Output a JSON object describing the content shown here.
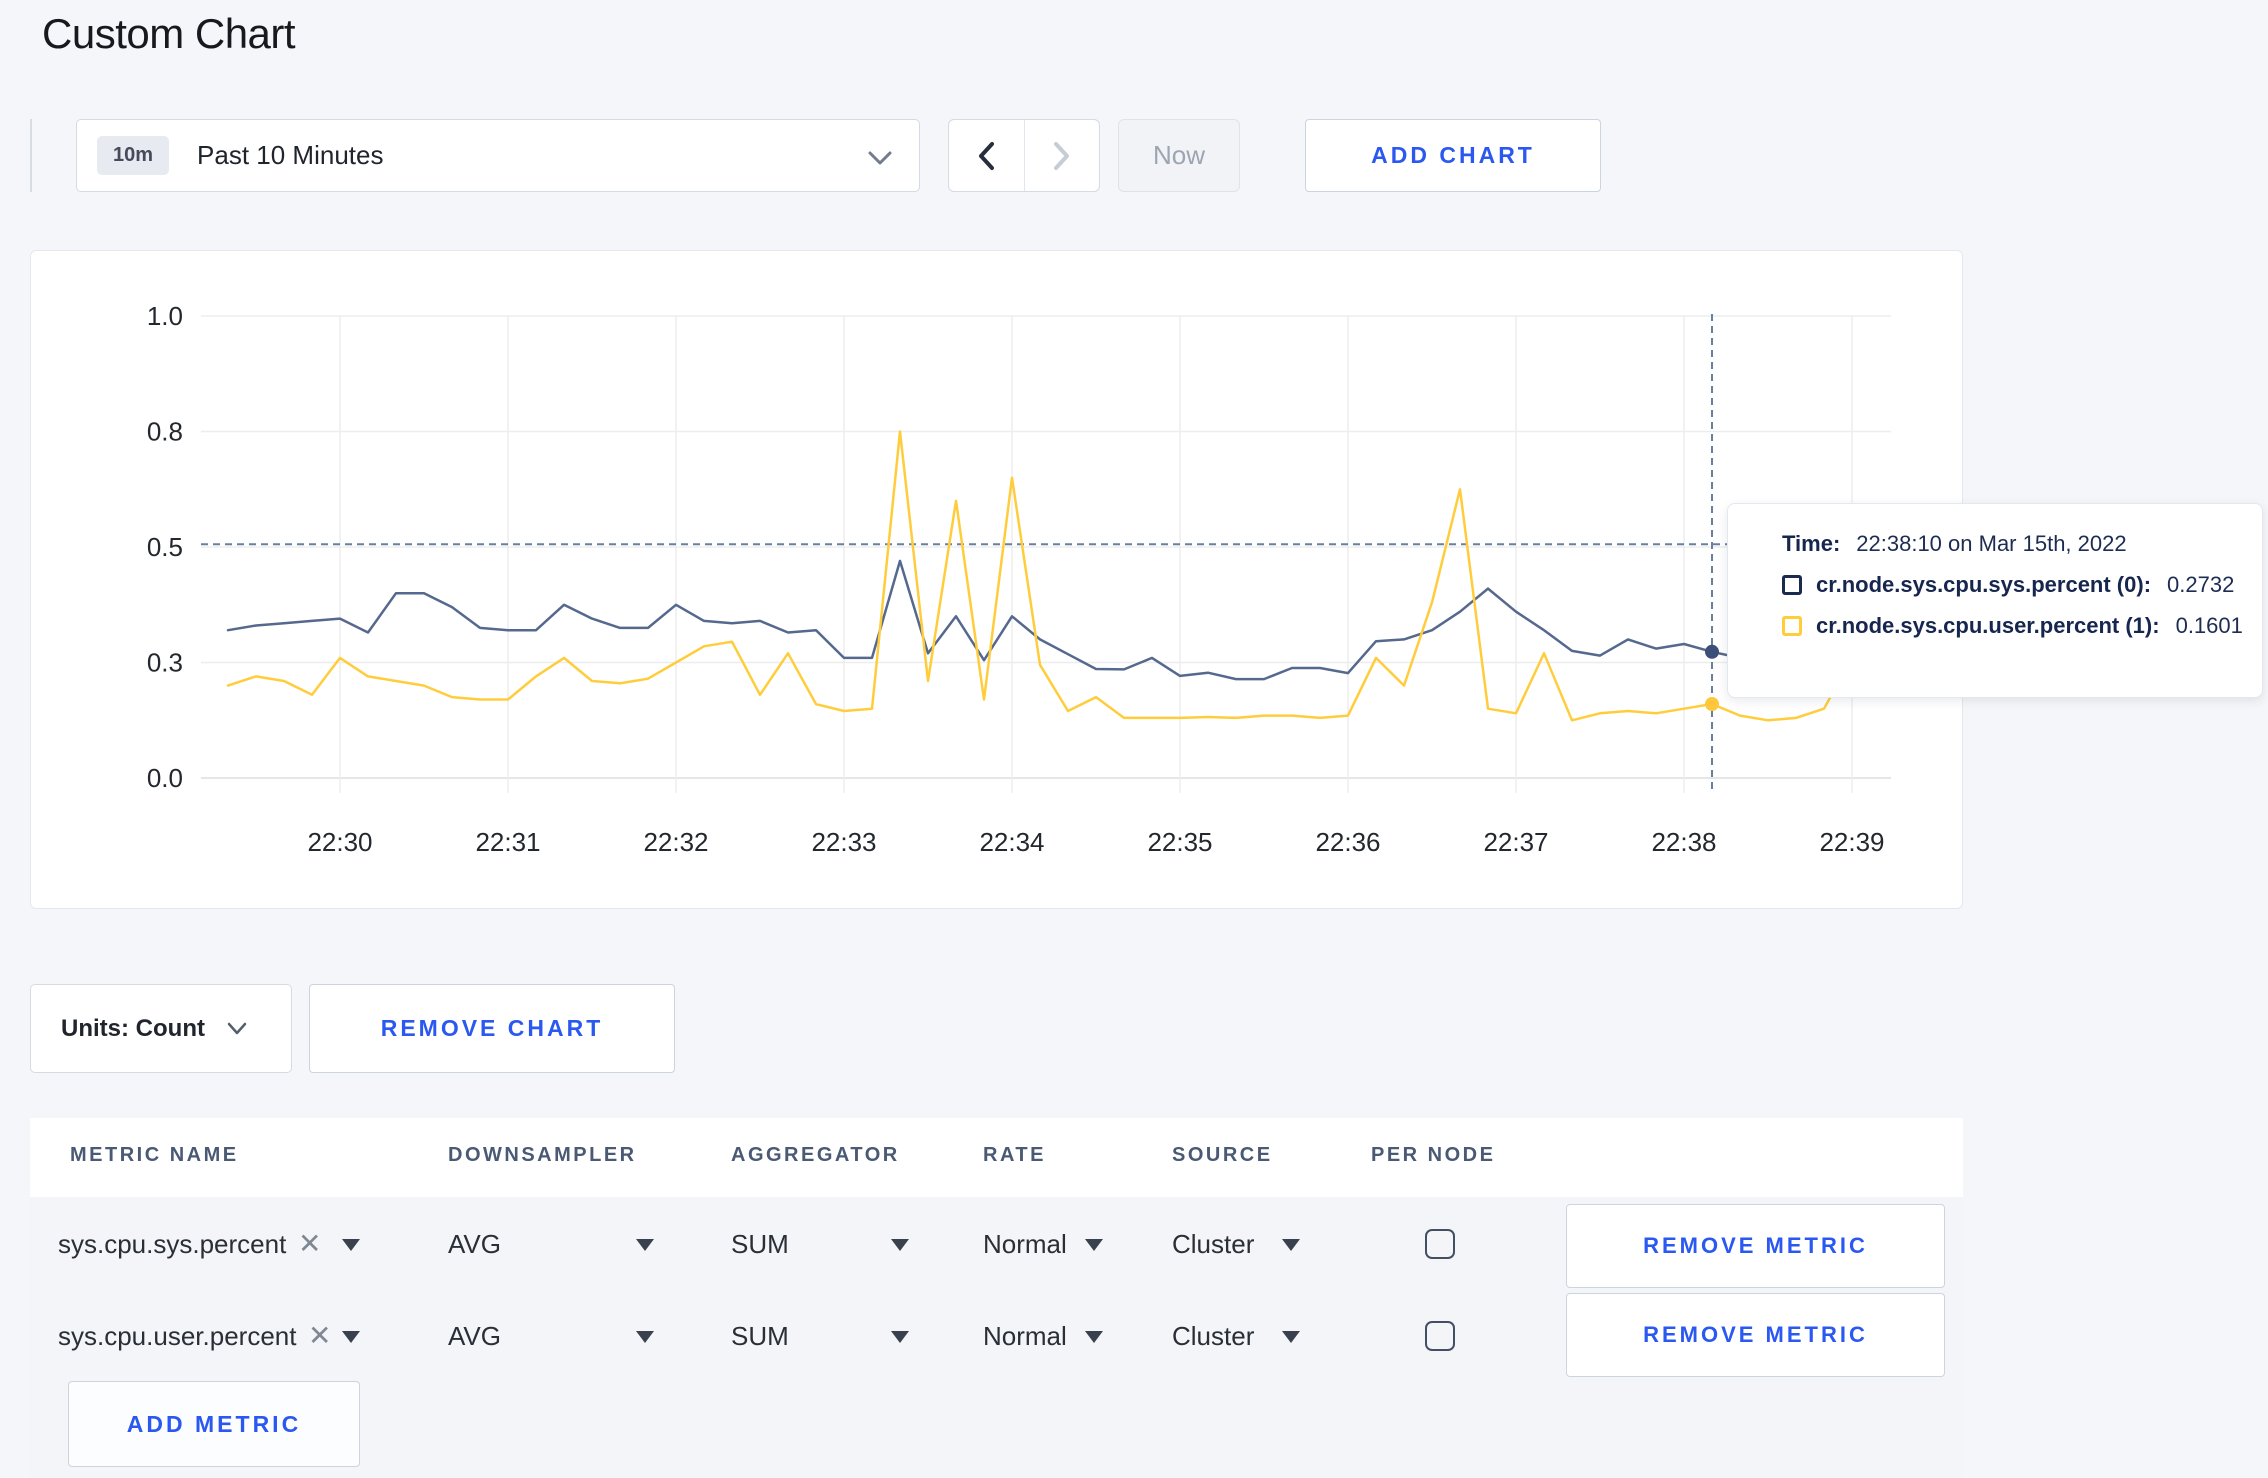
{
  "page": {
    "title": "Custom Chart"
  },
  "toolbar": {
    "time_badge": "10m",
    "time_label": "Past 10 Minutes",
    "now_label": "Now",
    "add_chart_label": "ADD CHART"
  },
  "tooltip": {
    "time_label": "Time:",
    "time_value": "22:38:10 on Mar 15th, 2022",
    "rows": [
      {
        "name": "cr.node.sys.cpu.sys.percent (0):",
        "value": "0.2732",
        "color": "#1b2b4e"
      },
      {
        "name": "cr.node.sys.cpu.user.percent (1):",
        "value": "0.1601",
        "color": "#ffcd3c"
      }
    ]
  },
  "units_bar": {
    "units_label": "Units: Count",
    "remove_chart_label": "REMOVE CHART"
  },
  "metrics_table": {
    "headers": [
      "METRIC NAME",
      "DOWNSAMPLER",
      "AGGREGATOR",
      "RATE",
      "SOURCE",
      "PER NODE"
    ],
    "rows": [
      {
        "metric": "sys.cpu.sys.percent",
        "downsampler": "AVG",
        "aggregator": "SUM",
        "rate": "Normal",
        "source": "Cluster",
        "per_node_checked": false,
        "remove_label": "REMOVE METRIC"
      },
      {
        "metric": "sys.cpu.user.percent",
        "downsampler": "AVG",
        "aggregator": "SUM",
        "rate": "Normal",
        "source": "Cluster",
        "per_node_checked": false,
        "remove_label": "REMOVE METRIC"
      }
    ],
    "add_metric_label": "ADD METRIC"
  },
  "chart_data": {
    "type": "line",
    "title": "",
    "xlabel": "",
    "ylabel": "",
    "ylim": [
      0,
      1
    ],
    "grid": true,
    "legend_position": "tooltip",
    "y_ticks": [
      {
        "label": "0.0",
        "value": 0
      },
      {
        "label": "0.3",
        "value": 0.25
      },
      {
        "label": "0.5",
        "value": 0.5
      },
      {
        "label": "0.8",
        "value": 0.75
      },
      {
        "label": "1.0",
        "value": 1
      }
    ],
    "x_ticks": [
      "22:30",
      "22:31",
      "22:32",
      "22:33",
      "22:34",
      "22:35",
      "22:36",
      "22:37",
      "22:38",
      "22:39"
    ],
    "start_time": "22:29:20",
    "interval_seconds": 10,
    "series": [
      {
        "name": "cr.node.sys.cpu.sys.percent (0)",
        "color": "#55688d",
        "values": [
          0.32,
          0.33,
          0.335,
          0.34,
          0.345,
          0.315,
          0.4,
          0.4,
          0.37,
          0.325,
          0.32,
          0.32,
          0.375,
          0.345,
          0.325,
          0.325,
          0.375,
          0.34,
          0.335,
          0.34,
          0.315,
          0.32,
          0.26,
          0.26,
          0.47,
          0.27,
          0.35,
          0.255,
          0.35,
          0.3,
          0.268,
          0.236,
          0.235,
          0.26,
          0.221,
          0.228,
          0.214,
          0.214,
          0.238,
          0.238,
          0.227,
          0.296,
          0.3,
          0.32,
          0.36,
          0.41,
          0.36,
          0.32,
          0.275,
          0.265,
          0.3,
          0.28,
          0.29,
          0.2732,
          0.26,
          0.27,
          0.275,
          0.28,
          0.29,
          0.3
        ]
      },
      {
        "name": "cr.node.sys.cpu.user.percent (1)",
        "color": "#ffcd3c",
        "values": [
          0.2,
          0.22,
          0.21,
          0.18,
          0.26,
          0.22,
          0.21,
          0.2,
          0.175,
          0.17,
          0.17,
          0.22,
          0.26,
          0.21,
          0.205,
          0.215,
          0.25,
          0.285,
          0.295,
          0.18,
          0.27,
          0.16,
          0.145,
          0.15,
          0.75,
          0.21,
          0.6,
          0.17,
          0.65,
          0.245,
          0.145,
          0.175,
          0.13,
          0.13,
          0.13,
          0.132,
          0.13,
          0.135,
          0.135,
          0.13,
          0.135,
          0.26,
          0.2,
          0.38,
          0.625,
          0.15,
          0.14,
          0.27,
          0.125,
          0.14,
          0.145,
          0.14,
          0.15,
          0.1601,
          0.135,
          0.125,
          0.13,
          0.15,
          0.26,
          0.2
        ]
      }
    ],
    "crosshair": {
      "time": "22:38:10",
      "minutes_after_2230": 8.1667,
      "h_value": 0.506,
      "points": [
        {
          "series": 0,
          "value": 0.2732
        },
        {
          "series": 1,
          "value": 0.1601
        }
      ]
    }
  }
}
